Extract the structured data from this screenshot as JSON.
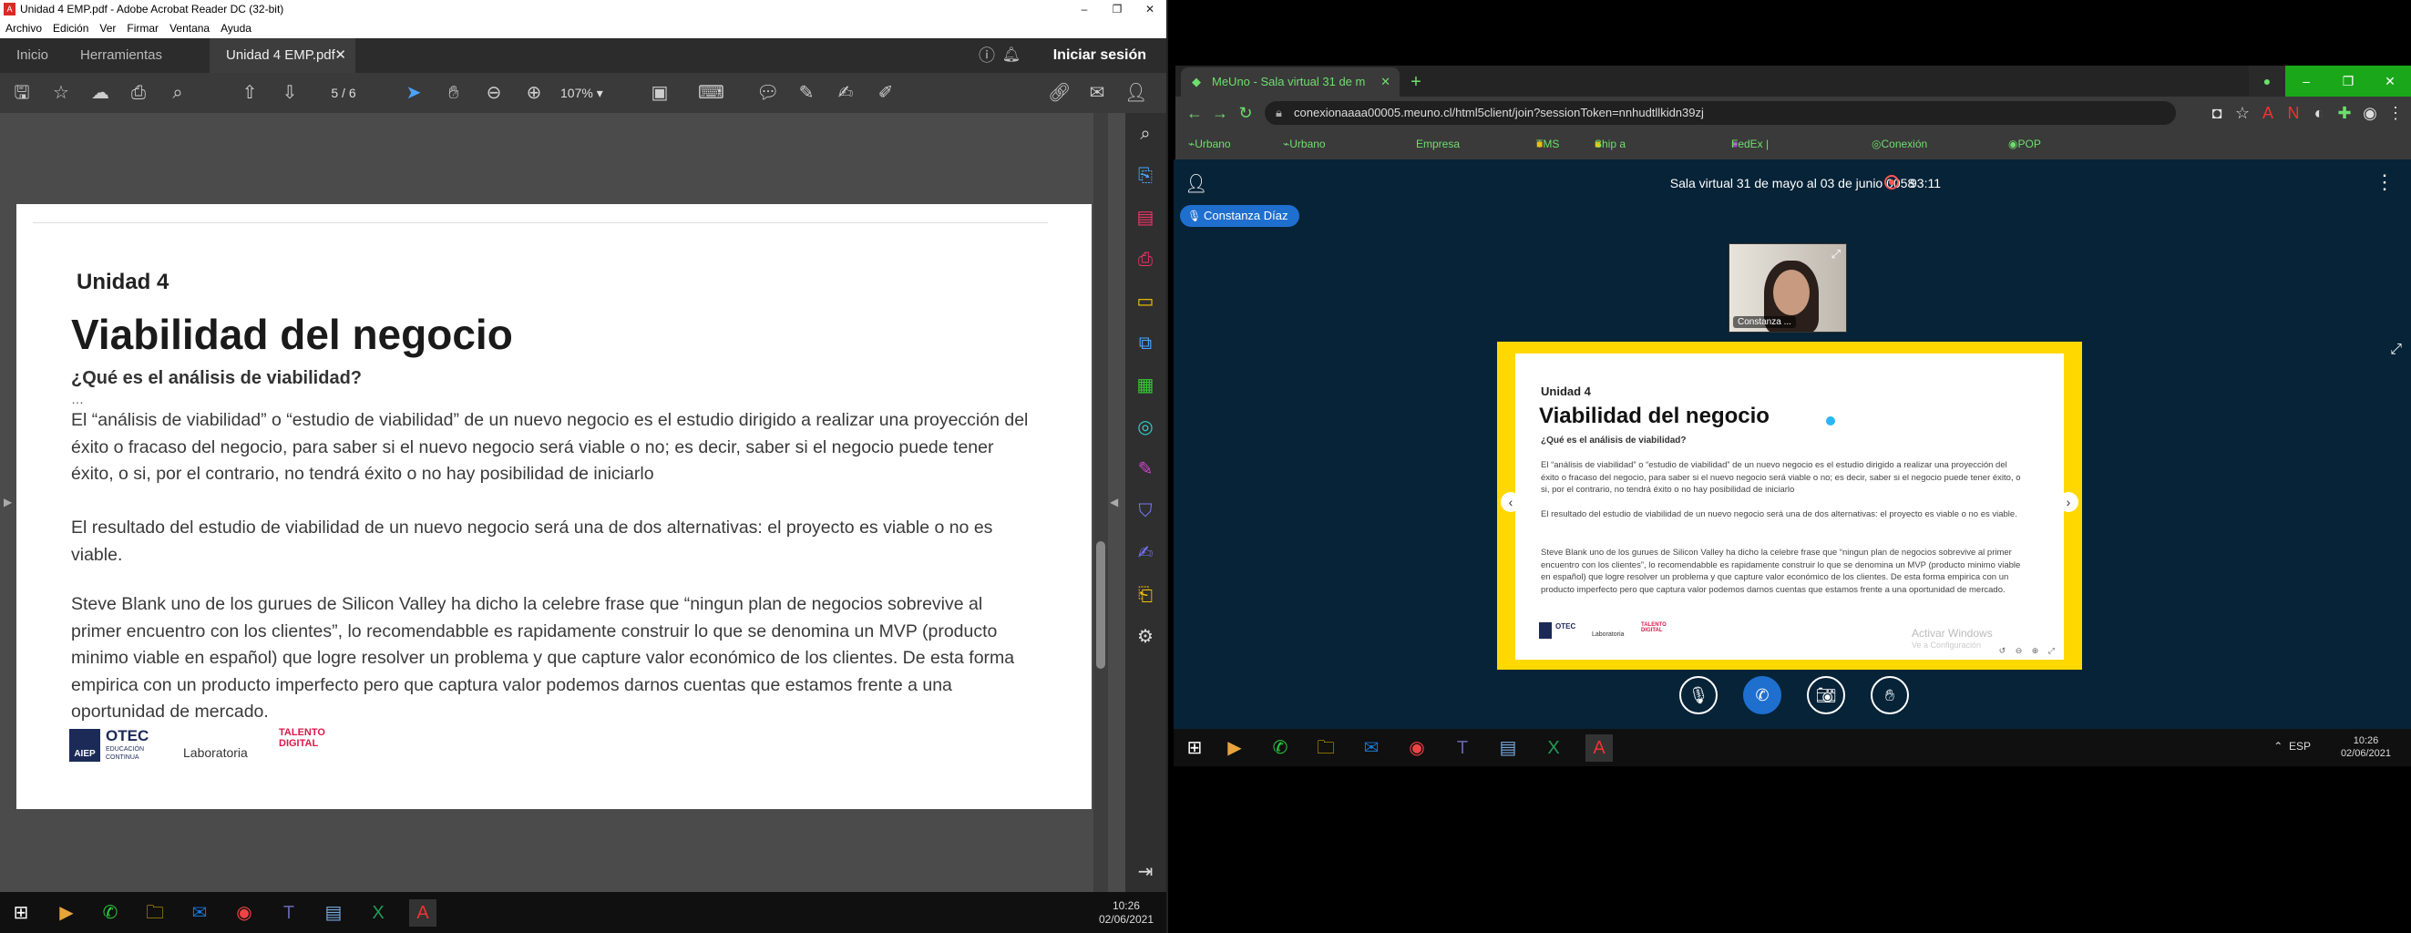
{
  "acrobat": {
    "title": "Unidad 4 EMP.pdf - Adobe Acrobat Reader DC (32-bit)",
    "menu": [
      "Archivo",
      "Edición",
      "Ver",
      "Firmar",
      "Ventana",
      "Ayuda"
    ],
    "tabs": {
      "home": "Inicio",
      "tools": "Herramientas",
      "doc": "Unidad 4 EMP.pdf",
      "signin": "Iniciar sesión"
    },
    "page_current": "5",
    "page_sep": "/",
    "page_total": "6",
    "zoom": "107%",
    "doc": {
      "unit": "Unidad 4",
      "title": "Viabilidad del negocio",
      "subtitle": "¿Qué es el análisis de viabilidad?",
      "dots": "…",
      "p1": "El “análisis de viabilidad” o “estudio de viabilidad” de un nuevo negocio es el estudio dirigido a realizar una proyección del éxito o fracaso del negocio, para saber si el nuevo negocio será viable o no; es decir, saber si el negocio puede tener éxito, o si, por el contrario, no tendrá éxito o no  hay posibilidad de iniciarlo",
      "p2": "El resultado del estudio de viabilidad de un nuevo negocio será una de dos alternativas: el proyecto es viable o no es viable.",
      "p3": "Steve Blank uno de los gurues de Silicon Valley ha dicho la celebre frase que “ningun plan de negocios sobrevive al primer encuentro con los clientes”, lo recomendabble es rapidamente construir lo que se denomina un MVP (producto minimo viable en español) que logre resolver un problema y que capture valor económico de los clientes. De esta forma empirica con un producto imperfecto pero que captura valor podemos darnos cuentas que estamos frente a una oportunidad de mercado.",
      "logos": {
        "aiep": "AIEP",
        "otec": "OTEC",
        "otec_sub": "EDUCACIÓN CONTINUA",
        "lab": "Laboratoria",
        "talento": "TALENTO DIGITAL"
      }
    }
  },
  "taskbar_left": {
    "time": "10:26",
    "date": "02/06/2021"
  },
  "chrome": {
    "tab_title": "MeUno - Sala virtual 31 de m",
    "url": "conexionaaaa00005.meuno.cl/html5client/join?sessionToken=nnhudtllkidn39zj",
    "bookmarks": [
      "Urbano Portal",
      "Urbano Holding",
      "Empresa de Courier...",
      "TMS",
      "Ship a parcel, shipp...",
      "FedEx | Entrega exp...",
      "Conexión Oracle Pe...",
      "POP Center | Acceso"
    ]
  },
  "meeting": {
    "room": "Sala virtual 31 de mayo al 03 de junio 0058",
    "timer": "93:11",
    "presenter": "Constanza Díaz",
    "cam_label": "Constanza ...",
    "slide": {
      "unit": "Unidad 4",
      "title": "Viabilidad del negocio",
      "subtitle": "¿Qué es el análisis de viabilidad?",
      "p1": "El “análisis de viabilidad” o “estudio de viabilidad” de un nuevo negocio es el estudio dirigido a realizar una proyección del éxito o fracaso del negocio, para saber si el nuevo negocio será viable o no; es decir, saber si el negocio puede tener éxito, o si, por el contrario, no tendrá éxito o no  hay posibilidad de iniciarlo",
      "p2": "El resultado del estudio de viabilidad de un nuevo negocio será una de dos alternativas: el proyecto es viable o no es viable.",
      "p3": "Steve Blank uno de los gurues de Silicon Valley ha dicho la celebre frase que “ningun plan de negocios sobrevive al primer encuentro con los clientes”, lo recomendabble es rapidamente construir lo que se denomina un MVP (producto minimo viable en español) que logre resolver un problema y que capture valor económico de los clientes. De esta forma empirica con un producto imperfecto pero que captura valor podemos darnos cuentas que estamos frente a una oportunidad de mercado.",
      "watermark": "Activar Windows",
      "watermark_sub": "Ve a Configuración"
    }
  },
  "taskbar_right": {
    "lang": "ESP",
    "time": "10:26",
    "date": "02/06/2021"
  },
  "colors": {
    "acrobat_bg": "#323232",
    "meeting_bg": "#062338",
    "share_border": "#ffd800",
    "accent_blue": "#1f6fcf",
    "chrome_green": "#6ddf6d"
  }
}
